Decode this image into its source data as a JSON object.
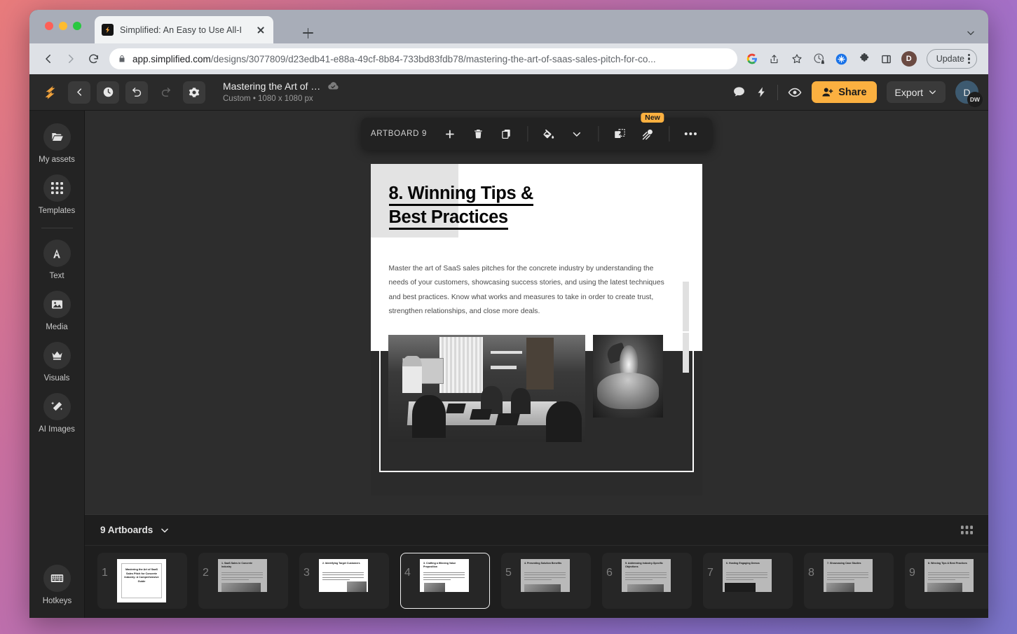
{
  "browser": {
    "tab": {
      "title": "Simplified: An Easy to Use All-I",
      "favicon": "simplified-logo-icon"
    },
    "new_tab_label": "+",
    "url_prefix": "app.simplified.com",
    "url_rest": "/designs/3077809/d23edb41-e88a-49cf-8b84-733bd83fdb78/mastering-the-art-of-saas-sales-pitch-for-co...",
    "update_label": "Update",
    "profile_initial": "D",
    "icons": [
      "back-icon",
      "forward-icon",
      "reload-icon",
      "lock-icon",
      "google-icon",
      "share-icon",
      "bookmark-star-icon",
      "history-lock-icon",
      "extension-blue-icon",
      "puzzle-icon",
      "sidepanel-icon"
    ]
  },
  "appbar": {
    "doc_title": "Mastering the Art of …",
    "doc_subtitle": "Custom • 1080 x 1080 px",
    "share_label": "Share",
    "export_label": "Export",
    "avatar_initial": "D",
    "avatar_badge": "DW"
  },
  "sidebar": {
    "items": [
      {
        "label": "My assets",
        "icon": "folder-icon"
      },
      {
        "label": "Templates",
        "icon": "grid-icon"
      },
      {
        "label": "Text",
        "icon": "text-a-icon"
      },
      {
        "label": "Media",
        "icon": "image-icon"
      },
      {
        "label": "Visuals",
        "icon": "crown-icon"
      },
      {
        "label": "AI Images",
        "icon": "magic-wand-icon"
      }
    ],
    "bottom": {
      "label": "Hotkeys",
      "icon": "keyboard-icon"
    }
  },
  "artboard_toolbar": {
    "label": "ARTBOARD 9",
    "badge": "New",
    "buttons": [
      "add-artboard-icon",
      "delete-artboard-icon",
      "duplicate-artboard-icon",
      "fill-color-icon",
      "chevron-down-icon",
      "resize-artboard-icon",
      "animate-icon",
      "more-options-icon"
    ]
  },
  "slide": {
    "title_line1": "8. Winning Tips &",
    "title_line2": "Best Practices",
    "body": "Master the art of SaaS sales pitches for the concrete industry by understanding the needs of your customers, showcasing success stories, and using the latest techniques and best practices. Know what works and measures to take in order to create trust, strengthen relationships, and close more deals.",
    "image1_alt": "conference-room-meeting-photo",
    "image2_alt": "hands-holding-lightbulb-photo"
  },
  "bottom_panel": {
    "title": "9 Artboards",
    "grid_view_icon": "grid-view-icon",
    "collapse_icon": "chevron-down-icon",
    "selected_index": 4,
    "thumbnails": [
      {
        "num": "1",
        "title": "Mastering the Art of SaaS Sales Pitch for Concrete Industry: A Comprehensive Guide",
        "style": "cover"
      },
      {
        "num": "2",
        "title": "1. SaaS Sales in Concrete Industry",
        "style": "content"
      },
      {
        "num": "3",
        "title": "2. Identifying Target Customers",
        "style": "content"
      },
      {
        "num": "4",
        "title": "3. Crafting a Winning Value Proposition",
        "style": "content"
      },
      {
        "num": "5",
        "title": "4. Presenting Solution Benefits",
        "style": "content"
      },
      {
        "num": "6",
        "title": "5. Addressing Industry-Specific Objections",
        "style": "content"
      },
      {
        "num": "7",
        "title": "6. Hosting Engaging Demos",
        "style": "content"
      },
      {
        "num": "8",
        "title": "7. Showcasing Case Studies",
        "style": "content"
      },
      {
        "num": "9",
        "title": "8. Winning Tips & Best Practices",
        "style": "content"
      }
    ]
  },
  "fab": {
    "icon": "ai-cube-icon"
  },
  "colors": {
    "accent": "#fbb040",
    "app_bg": "#1e1e1e",
    "canvas_bg": "#2d2d2d"
  }
}
